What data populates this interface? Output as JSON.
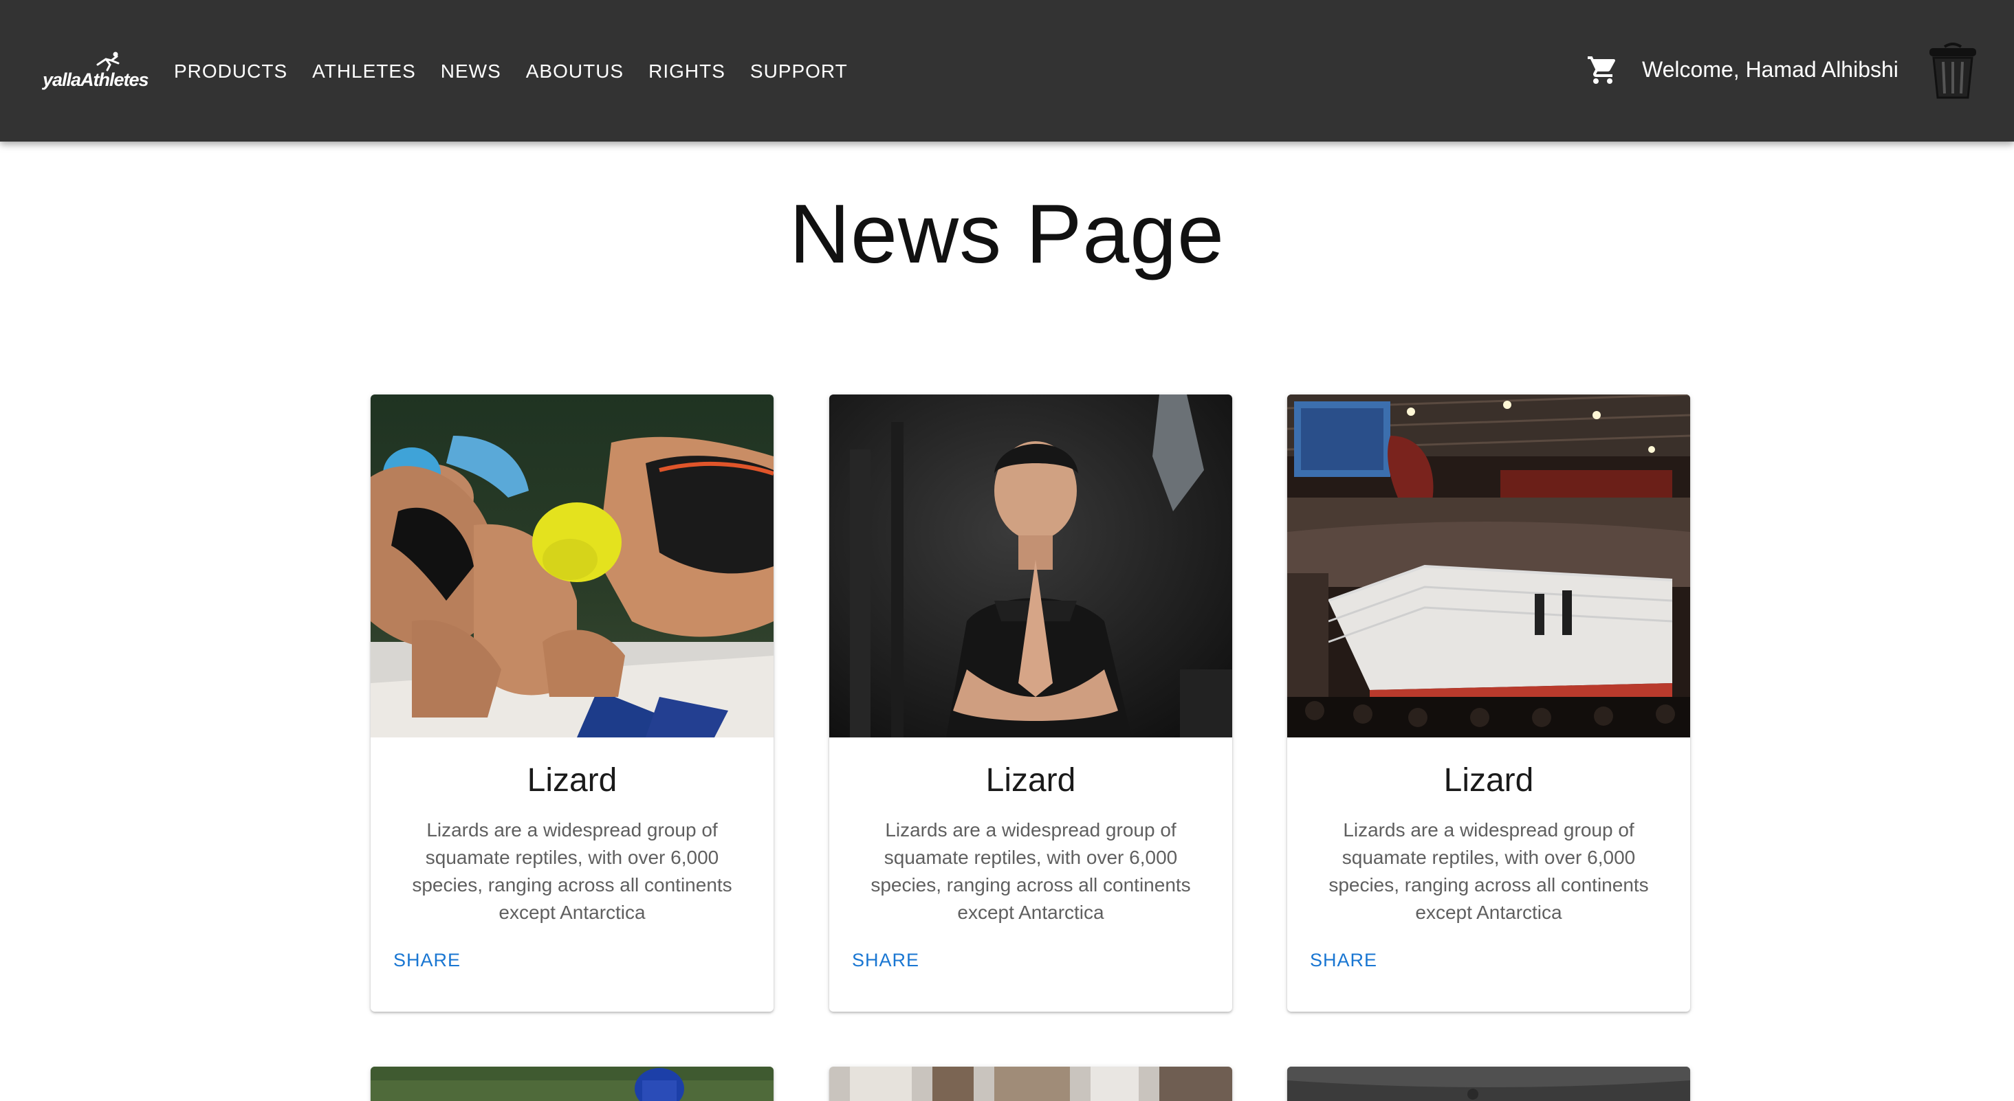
{
  "header": {
    "logo_text": "yallaAthletes",
    "nav": [
      "PRODUCTS",
      "ATHLETES",
      "NEWS",
      "ABOUTUS",
      "RIGHTS",
      "SUPPORT"
    ],
    "welcome": "Welcome, Hamad Alhibshi",
    "cart_icon": "shopping-cart-icon",
    "avatar_icon": "trash-bin-icon"
  },
  "page": {
    "title": "News Page"
  },
  "cards": [
    {
      "image": "swimmers-at-starting-blocks",
      "title": "Lizard",
      "text": "Lizards are a widespread group of squamate reptiles, with over 6,000 species, ranging across all continents except Antarctica",
      "action": "SHARE"
    },
    {
      "image": "man-meditating",
      "title": "Lizard",
      "text": "Lizards are a widespread group of squamate reptiles, with over 6,000 species, ranging across all continents except Antarctica",
      "action": "SHARE"
    },
    {
      "image": "boxing-arena",
      "title": "Lizard",
      "text": "Lizards are a widespread group of squamate reptiles, with over 6,000 species, ranging across all continents except Antarctica",
      "action": "SHARE"
    }
  ],
  "colors": {
    "appbar": "#333333",
    "link": "#1976d2",
    "body_text": "#5f5f5f"
  }
}
